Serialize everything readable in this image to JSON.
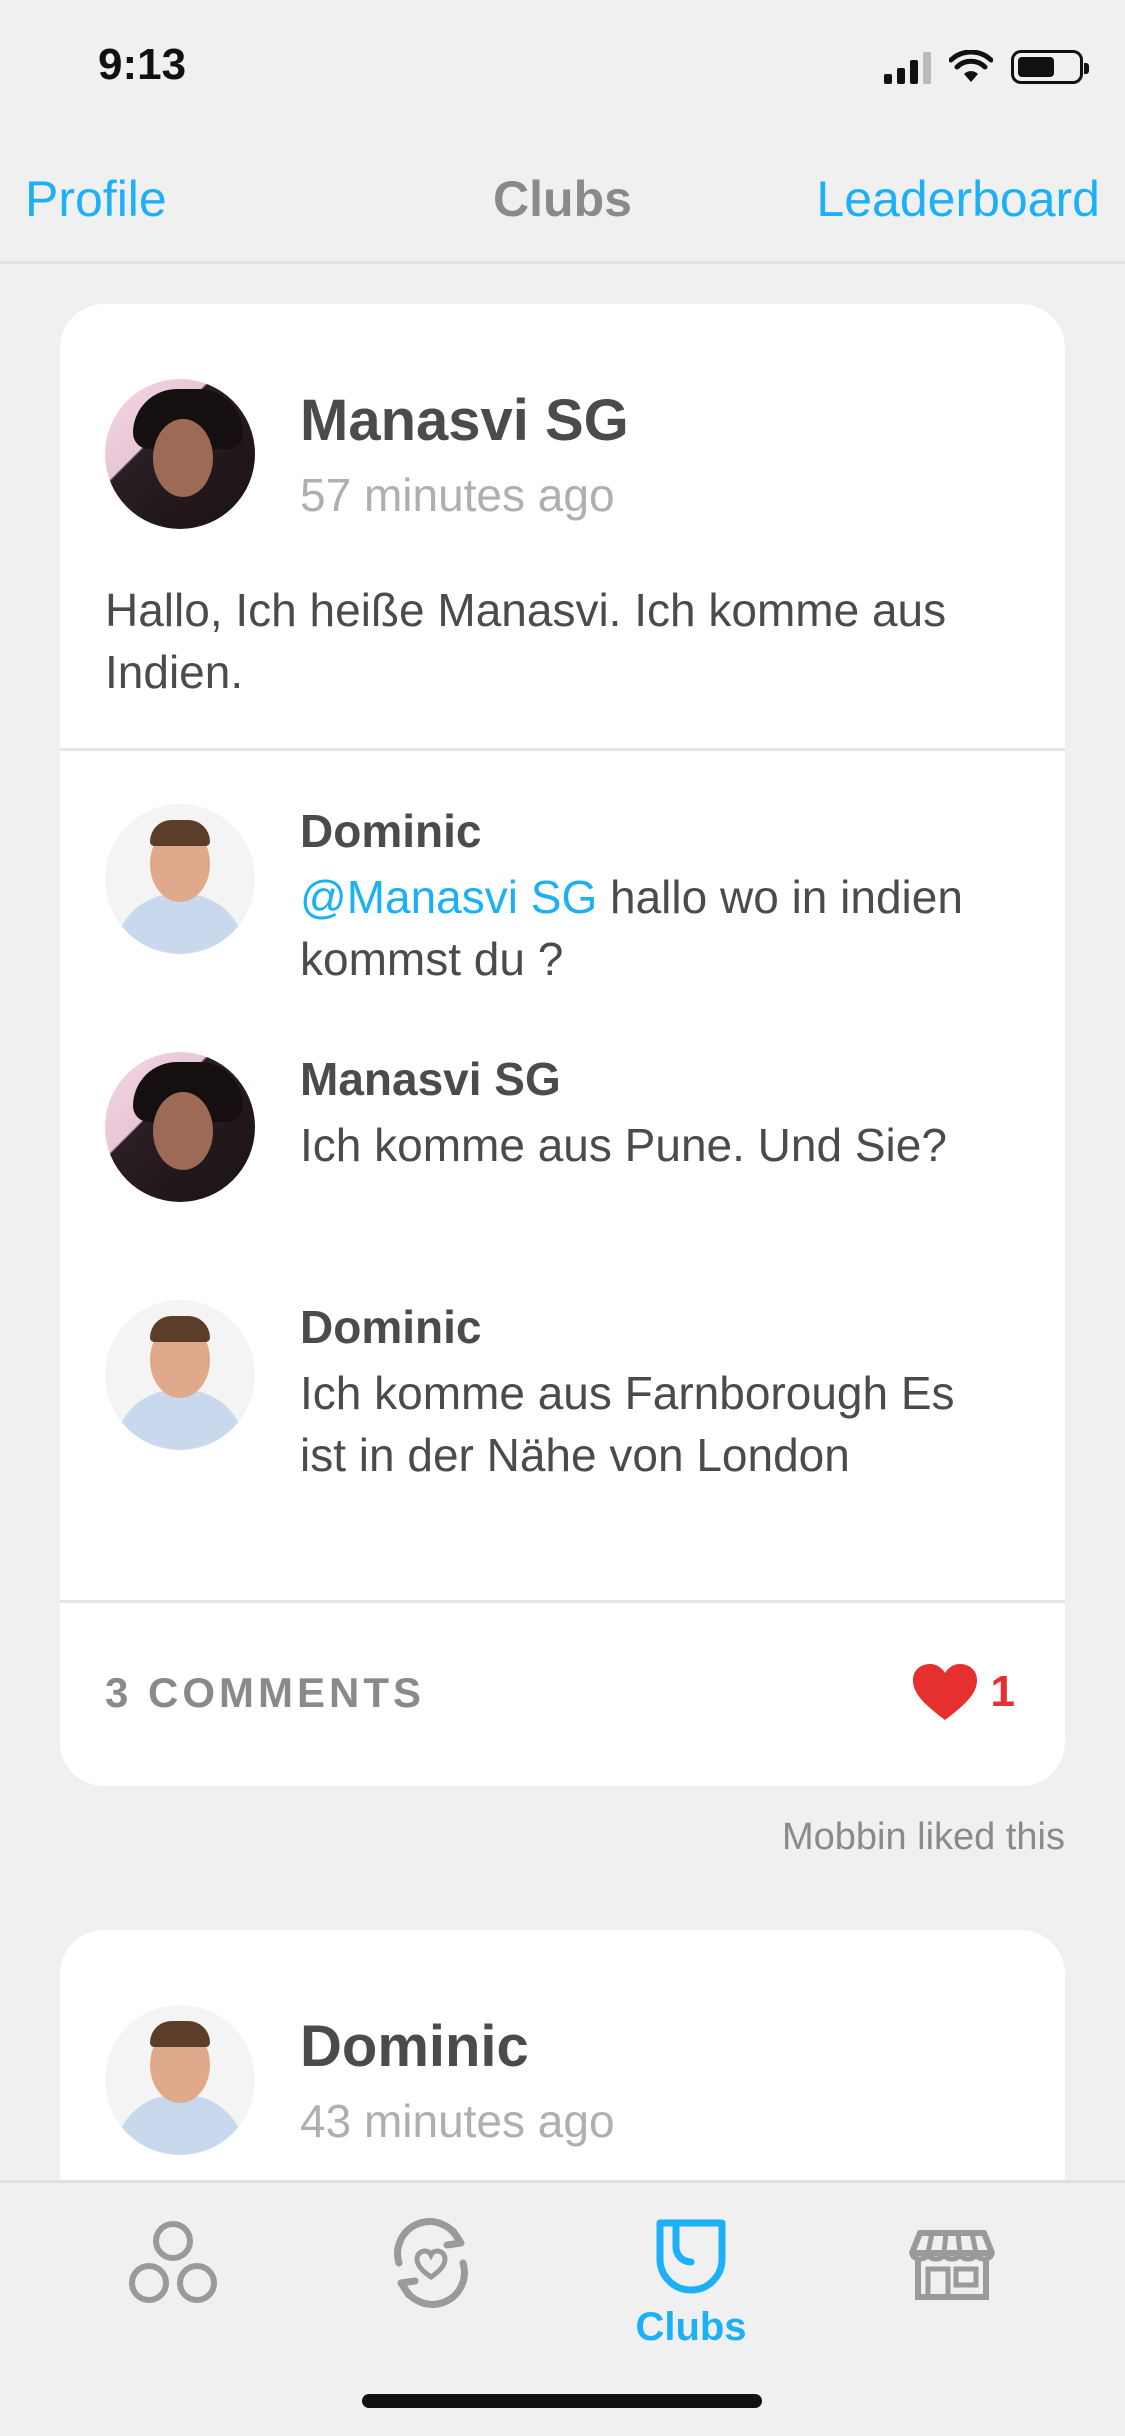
{
  "status_bar": {
    "time": "9:13"
  },
  "nav": {
    "left": "Profile",
    "title": "Clubs",
    "right": "Leaderboard"
  },
  "post1": {
    "author": "Manasvi SG",
    "time": "57 minutes ago",
    "body": "Hallo, Ich heiße Manasvi. Ich komme aus Indien.",
    "comments": [
      {
        "author": "Dominic",
        "mention": "@Manasvi SG",
        "text": " hallo wo in indien kommst du ?"
      },
      {
        "author": "Manasvi SG",
        "text": "Ich komme aus Pune. Und Sie?"
      },
      {
        "author": "Dominic",
        "text": "Ich komme aus Farnborough Es ist in der Nähe von London"
      }
    ],
    "comments_count": "3 COMMENTS",
    "likes": "1",
    "liked_by": "Mobbin liked this"
  },
  "post2": {
    "author": "Dominic",
    "time": "43 minutes ago"
  },
  "tabs": {
    "clubs_label": "Clubs"
  },
  "colors": {
    "accent": "#1cb0f6",
    "like": "#e5302f",
    "text": "#4b4b4b",
    "muted": "#afafaf"
  }
}
